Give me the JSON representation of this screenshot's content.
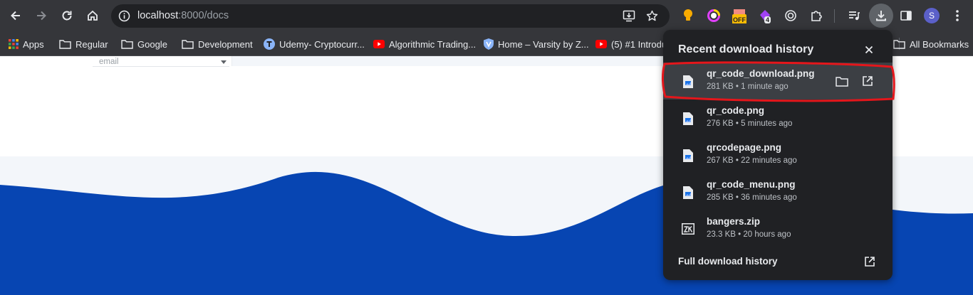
{
  "browser": {
    "url_host": "localhost",
    "url_rest": ":8000/docs",
    "extension_badges": {
      "off": "OFF",
      "count": "4"
    },
    "profile_initial": "S"
  },
  "bookmarks": [
    {
      "label": "Apps",
      "icon": "apps-grid-icon"
    },
    {
      "label": "Regular",
      "icon": "folder-icon"
    },
    {
      "label": "Google",
      "icon": "folder-icon"
    },
    {
      "label": "Development",
      "icon": "folder-icon"
    },
    {
      "label": "Udemy- Cryptocurr...",
      "icon": "udemy-icon"
    },
    {
      "label": "Algorithmic Trading...",
      "icon": "youtube-icon"
    },
    {
      "label": "Home – Varsity by Z...",
      "icon": "varsity-icon"
    },
    {
      "label": "(5) #1 Introdu",
      "icon": "youtube-icon"
    }
  ],
  "all_bookmarks_label": "All Bookmarks",
  "page": {
    "email_placeholder": "email",
    "colors": {
      "wave": "#0745b2",
      "band": "#f3f6fa"
    }
  },
  "downloads": {
    "title": "Recent download history",
    "items": [
      {
        "name": "qr_code_download.png",
        "meta": "281 KB • 1 minute ago",
        "type": "image"
      },
      {
        "name": "qr_code.png",
        "meta": "276 KB • 5 minutes ago",
        "type": "image"
      },
      {
        "name": "qrcodepage.png",
        "meta": "267 KB • 22 minutes ago",
        "type": "image"
      },
      {
        "name": "qr_code_menu.png",
        "meta": "285 KB • 36 minutes ago",
        "type": "image"
      },
      {
        "name": "bangers.zip",
        "meta": "23.3 KB • 20 hours ago",
        "type": "archive"
      }
    ],
    "full_history_label": "Full download history"
  }
}
